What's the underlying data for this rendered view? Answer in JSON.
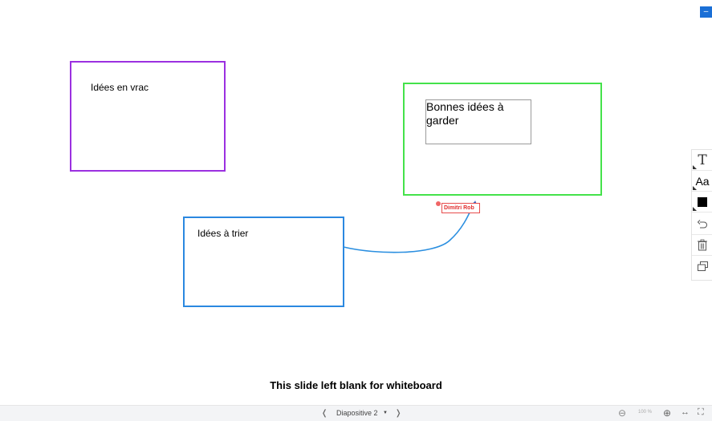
{
  "window": {
    "minimize_label": "–"
  },
  "whiteboard": {
    "boxes": [
      {
        "label": "Idées en vrac",
        "color": "#9b30e0"
      },
      {
        "label": "Bonnes idées à garder",
        "color": "#44e24a"
      },
      {
        "label": "Idées à trier",
        "color": "#2b88e0"
      }
    ],
    "connector_color": "#2b8fe0",
    "author_tag": "Dimitri Rob",
    "caption": "This slide left blank for whiteboard"
  },
  "toolbar": {
    "text_tool": "T",
    "font_tool": "Aa",
    "color_swatch": "#000000",
    "icons": [
      "text-icon",
      "font-size-icon",
      "color-swatch-icon",
      "undo-icon",
      "trash-icon",
      "copy-icon"
    ]
  },
  "bottombar": {
    "prev": "❬",
    "slide_label": "Diapositive 2",
    "dropdown": "▼",
    "next": "❭",
    "zoom_out": "⊖",
    "zoom_value": "100 %",
    "zoom_in": "⊕",
    "fit_width": "↔",
    "fullscreen": "⛶"
  }
}
